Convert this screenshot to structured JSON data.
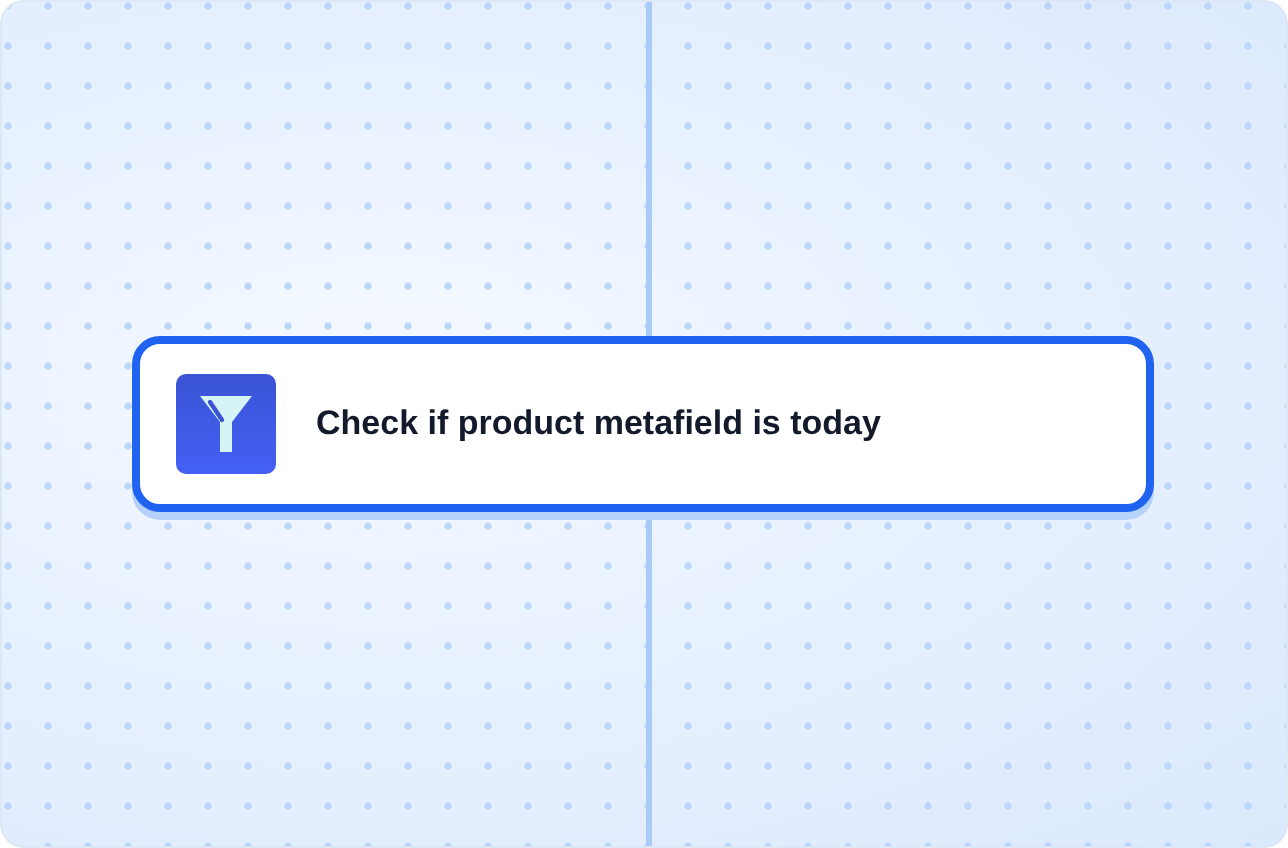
{
  "node": {
    "title": "Check if product metafield is today",
    "selected": true
  }
}
